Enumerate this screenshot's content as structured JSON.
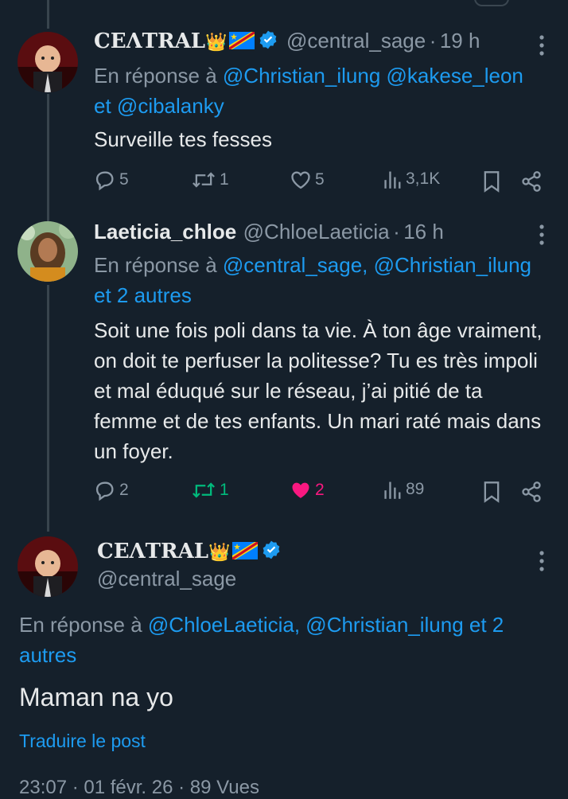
{
  "tweet1": {
    "display_name": "CEɅTRAL",
    "crown": "👑",
    "handle": "@central_sage",
    "sep": "·",
    "time": "19 h",
    "reply_prefix": "En réponse à",
    "reply_mentions_line1": "@Christian_ilung @kakese_leon",
    "reply_and": "et",
    "reply_mentions_line2": "@cibalanky",
    "text": "Surveille tes fesses",
    "replies": "5",
    "retweets": "1",
    "likes": "5",
    "views": "3,1K"
  },
  "tweet2": {
    "display_name": "Laeticia_chloe",
    "handle": "@ChloeLaeticia",
    "sep": "·",
    "time": "16 h",
    "reply_prefix": "En réponse à",
    "reply_mentions_line1": "@central_sage, @Christian_ilung",
    "reply_others": "et 2 autres",
    "text": "Soit une fois poli dans ta vie. À ton âge vraiment, on doit te perfuser la politesse? Tu es très impoli et mal éduqué sur le réseau, j’ai pitié de ta femme et de tes enfants. Un mari raté mais dans un foyer.",
    "replies": "2",
    "retweets": "1",
    "likes": "2",
    "views": "89"
  },
  "main_tweet": {
    "display_name": "CEɅTRAL",
    "crown": "👑",
    "handle": "@central_sage",
    "reply_prefix": "En réponse à",
    "reply_mentions": "@ChloeLaeticia, @Christian_ilung et 2",
    "reply_mentions_line2": "autres",
    "text": "Maman na yo",
    "translate": "Traduire le post",
    "footer": "23:07 · 01 févr. 26 · 89 Vues"
  },
  "colors": {
    "background": "#15202b",
    "text": "#e7e9ea",
    "secondary": "#8b98a5",
    "link": "#1d9bf0",
    "retweet_active": "#00ba7c",
    "like_active": "#f91880",
    "verified": "#1d9bf0"
  }
}
